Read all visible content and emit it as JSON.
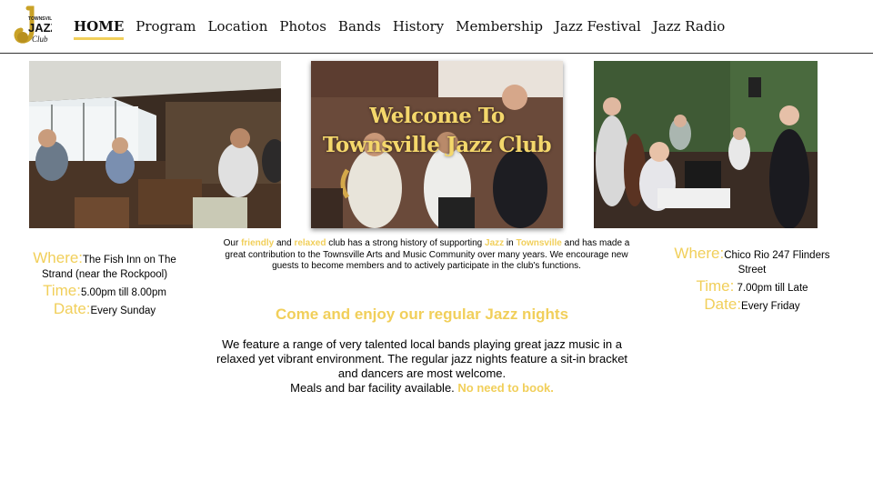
{
  "logo": {
    "text_top": "TOWNSVILLE",
    "text_main": "JAZZ",
    "text_sub": "Club",
    "icon": "saxophone-logo"
  },
  "nav": {
    "items": [
      {
        "label": "HOME",
        "active": true
      },
      {
        "label": "Program"
      },
      {
        "label": "Location"
      },
      {
        "label": "Photos"
      },
      {
        "label": "Bands"
      },
      {
        "label": "History"
      },
      {
        "label": "Membership"
      },
      {
        "label": "Jazz Festival"
      },
      {
        "label": "Jazz Radio"
      }
    ]
  },
  "hero": {
    "title": "Welcome To Townsville Jazz Club"
  },
  "intro": {
    "p1": "Our ",
    "w1": "friendly",
    "p2": " and ",
    "w2": "relaxed",
    "p3": " club has a strong history of supporting ",
    "w3": "Jazz",
    "p4": " in ",
    "w4": "Townsville",
    "p5": " and has made a great contribution to the Townsville Arts and Music Community over many years.  We encourage new guests to become members and to actively participate in the club's functions."
  },
  "venue_left": {
    "where_label": "Where:",
    "where_value": "The Fish Inn on The Strand (near the Rockpool)",
    "time_label": "Time:",
    "time_value": "5.00pm till 8.00pm",
    "date_label": "Date:",
    "date_value": "Every Sunday"
  },
  "venue_right": {
    "where_label": "Where:",
    "where_value": "Chico Rio 247 Flinders Street",
    "time_label": "Time:",
    "time_value": " 7.00pm till Late",
    "date_label": "Date:",
    "date_value": "Every Friday"
  },
  "headline": "Come and enjoy our regular Jazz nights",
  "feature": {
    "text": "We feature a range of very talented local bands playing great jazz music in a relaxed yet vibrant environment. The regular jazz nights feature a sit-in bracket and dancers are most welcome.",
    "meals": "Meals and bar facility available. ",
    "book": "No need to book."
  },
  "colors": {
    "accent": "#f1cf5a",
    "text": "#000000",
    "background": "#ffffff"
  }
}
